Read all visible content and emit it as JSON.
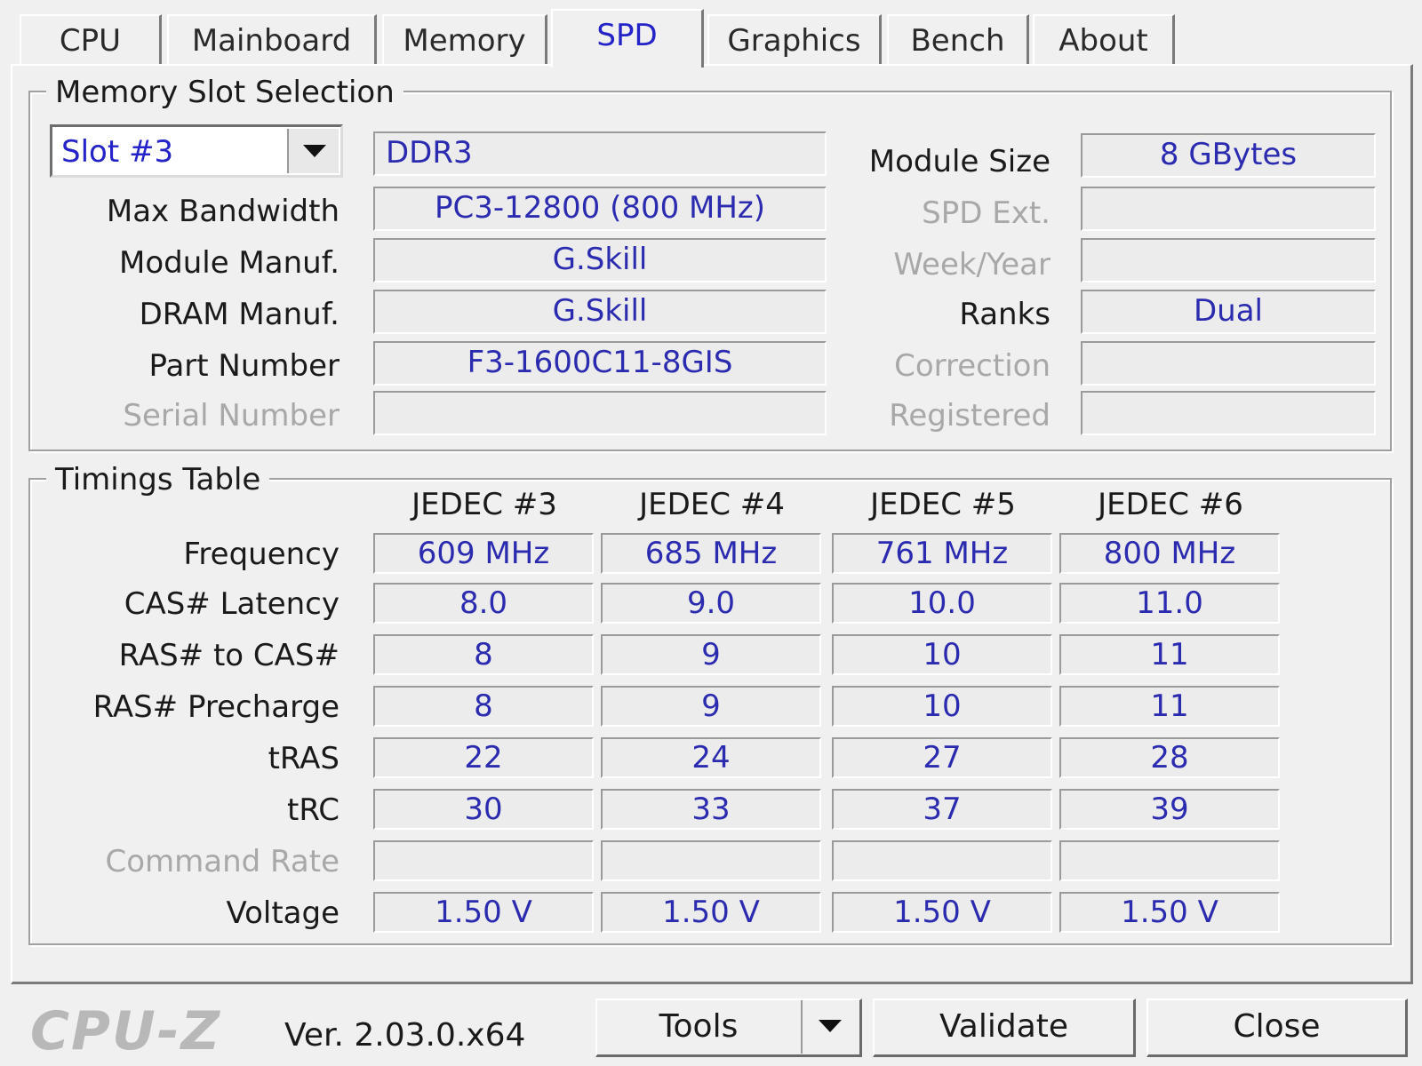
{
  "tabs": [
    "CPU",
    "Mainboard",
    "Memory",
    "SPD",
    "Graphics",
    "Bench",
    "About"
  ],
  "active_tab": "SPD",
  "slot_group": {
    "title": "Memory Slot Selection",
    "slot_selected": "Slot #3",
    "memory_type": "DDR3",
    "labels": {
      "max_bandwidth": "Max Bandwidth",
      "module_manuf": "Module Manuf.",
      "dram_manuf": "DRAM Manuf.",
      "part_number": "Part Number",
      "serial_number": "Serial Number",
      "module_size": "Module Size",
      "spd_ext": "SPD Ext.",
      "week_year": "Week/Year",
      "ranks": "Ranks",
      "correction": "Correction",
      "registered": "Registered"
    },
    "values": {
      "max_bandwidth": "PC3-12800 (800 MHz)",
      "module_manuf": "G.Skill",
      "dram_manuf": "G.Skill",
      "part_number": "F3-1600C11-8GIS",
      "serial_number": "",
      "module_size": "8 GBytes",
      "spd_ext": "",
      "week_year": "",
      "ranks": "Dual",
      "correction": "",
      "registered": ""
    }
  },
  "timings": {
    "title": "Timings Table",
    "columns": [
      "JEDEC #3",
      "JEDEC #4",
      "JEDEC #5",
      "JEDEC #6"
    ],
    "rows": [
      {
        "label": "Frequency",
        "values": [
          "609 MHz",
          "685 MHz",
          "761 MHz",
          "800 MHz"
        ]
      },
      {
        "label": "CAS# Latency",
        "values": [
          "8.0",
          "9.0",
          "10.0",
          "11.0"
        ]
      },
      {
        "label": "RAS# to CAS#",
        "values": [
          "8",
          "9",
          "10",
          "11"
        ]
      },
      {
        "label": "RAS# Precharge",
        "values": [
          "8",
          "9",
          "10",
          "11"
        ]
      },
      {
        "label": "tRAS",
        "values": [
          "22",
          "24",
          "27",
          "28"
        ]
      },
      {
        "label": "tRC",
        "values": [
          "30",
          "33",
          "37",
          "39"
        ]
      },
      {
        "label": "Command Rate",
        "values": [
          "",
          "",
          "",
          ""
        ]
      },
      {
        "label": "Voltage",
        "values": [
          "1.50 V",
          "1.50 V",
          "1.50 V",
          "1.50 V"
        ]
      }
    ]
  },
  "footer": {
    "logo": "CPU-Z",
    "version": "Ver. 2.03.0.x64",
    "tools": "Tools",
    "validate": "Validate",
    "close": "Close"
  }
}
